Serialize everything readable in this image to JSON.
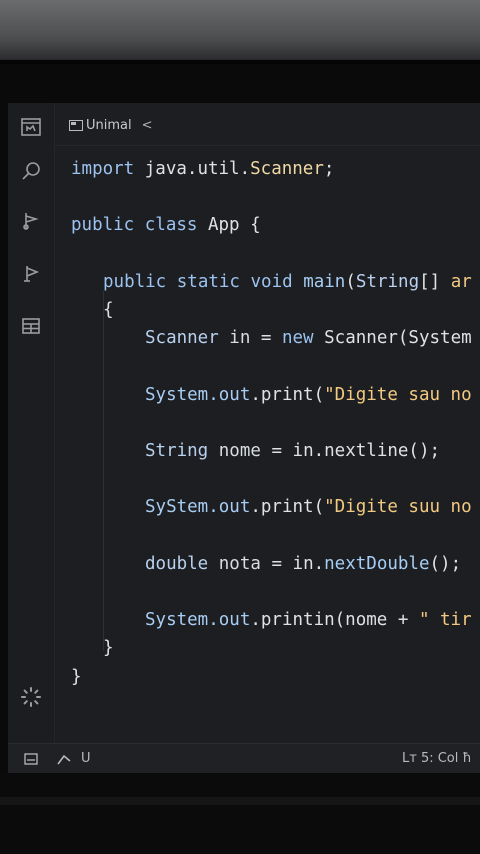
{
  "tab": {
    "filename": "Unimal",
    "chevron": "<"
  },
  "activity_icons": [
    "explorer-icon",
    "search-icon",
    "source-control-icon",
    "run-debug-icon",
    "extensions-icon",
    "settings-gear-icon"
  ],
  "code_lines": [
    [
      [
        "kw",
        "import "
      ],
      [
        "pl",
        "java.util."
      ],
      [
        "cls",
        "Scanner"
      ],
      [
        "pl",
        ";"
      ]
    ],
    [],
    [
      [
        "kw",
        "public class "
      ],
      [
        "pl",
        "App {"
      ]
    ],
    [],
    [
      [
        "kw",
        "public static void "
      ],
      [
        "fn",
        "main"
      ],
      [
        "pl",
        "("
      ],
      [
        "type",
        "String"
      ],
      [
        "pl",
        "[] "
      ],
      [
        "str",
        "ar"
      ]
    ],
    [
      [
        "pl",
        "{"
      ]
    ],
    [
      [
        "type",
        "Scanner "
      ],
      [
        "var",
        "in"
      ],
      [
        "pl",
        " = "
      ],
      [
        "kw",
        "new "
      ],
      [
        "pl",
        "Scanner(System"
      ]
    ],
    [],
    [
      [
        "fn",
        "System.out"
      ],
      [
        "pl",
        ".print("
      ],
      [
        "str",
        "\"Digite sau no"
      ]
    ],
    [],
    [
      [
        "type",
        "String "
      ],
      [
        "var",
        "nome"
      ],
      [
        "pl",
        " = in.nextline();"
      ]
    ],
    [],
    [
      [
        "fn",
        "SyStem.out"
      ],
      [
        "pl",
        ".print("
      ],
      [
        "str",
        "\"Digite suu no"
      ]
    ],
    [],
    [
      [
        "type",
        "double "
      ],
      [
        "var",
        "nota"
      ],
      [
        "pl",
        " = in."
      ],
      [
        "fn",
        "nextDouble"
      ],
      [
        "pl",
        "();"
      ]
    ],
    [],
    [
      [
        "fn",
        "System.out"
      ],
      [
        "pl",
        ".printin(nome + "
      ],
      [
        "str",
        "\" tir"
      ]
    ],
    [
      [
        "pl",
        "}"
      ]
    ],
    [
      [
        "pl",
        "}"
      ]
    ]
  ],
  "status": {
    "left_icon": "remote-icon",
    "branch_icon": "branch-icon",
    "branch": "U",
    "cursor_position": "Lт 5: Col ħ"
  }
}
